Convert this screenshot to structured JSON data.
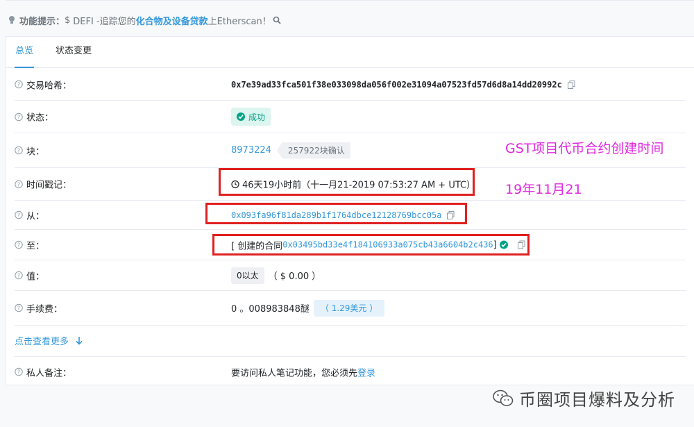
{
  "tip": {
    "label": "功能提示：",
    "dollar": "$",
    "prefix": "DEFI -追踪您的",
    "highlight": "化合物及设备贷款",
    "suffix": "上Etherscan！"
  },
  "tabs": [
    {
      "label": "总览",
      "active": true
    },
    {
      "label": "状态变更",
      "active": false
    }
  ],
  "rows": {
    "hash": {
      "label": "交易哈希：",
      "value": "0x7e39ad33fca501f38e033098da056f002e31094a07523fd57d6d8a14dd20992c"
    },
    "status": {
      "label": "状态：",
      "value": "成功"
    },
    "block": {
      "label": "块：",
      "number": "8973224",
      "confirmations": "257922块确认"
    },
    "timestamp": {
      "label": "时间戳记：",
      "value": "46天19小时前（十一月21-2019 07:53:27 AM + UTC）"
    },
    "from": {
      "label": "从：",
      "value": "0x093fa96f81da289b1f1764dbce12128769bcc05a"
    },
    "to": {
      "label": "至：",
      "prefix": "[ 创建的合同",
      "address": "0x03495bd33e4f184106933a075cb43a6604b2c436",
      "suffix": " ]"
    },
    "value": {
      "label": "值：",
      "amount": "0以太",
      "usd": "（ $ 0.00 ）"
    },
    "fee": {
      "label": "手续费：",
      "amount": "0 。008983848醚",
      "usd": "（ 1.29美元 ）"
    },
    "note": {
      "label": "私人备注：",
      "text": "要访问私人笔记功能，您必须先",
      "link": "登录"
    }
  },
  "more": "点击查看更多",
  "annotations": {
    "line1": "GST项目代币合约创建时间",
    "line2": "19年11月21"
  },
  "watermark": "币圈项目爆料及分析",
  "colors": {
    "accent": "#3498db",
    "success": "#00a186",
    "annotation": "#e026e0",
    "highlight_box": "#e02020"
  }
}
